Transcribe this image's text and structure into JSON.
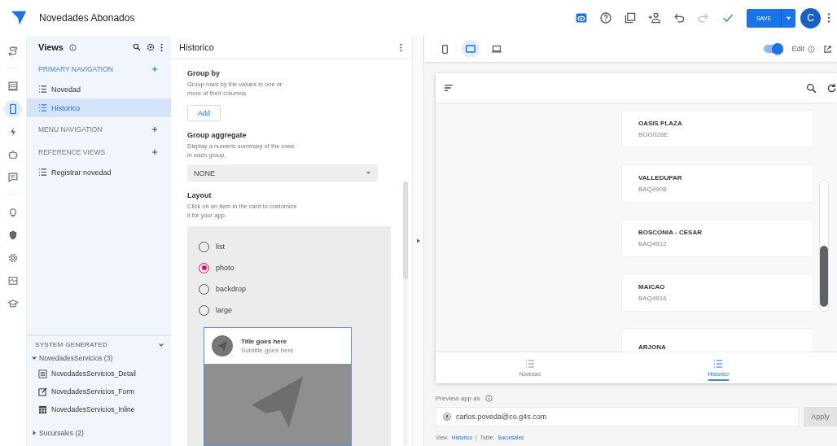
{
  "app": {
    "title": "Novedades Abonados",
    "save": "SAVE",
    "avatar": "C"
  },
  "views": {
    "title": "Views",
    "sections": [
      {
        "title": "PRIMARY NAVIGATION",
        "accent": true,
        "items": [
          {
            "label": "Novedad",
            "selected": false
          },
          {
            "label": "Historico",
            "selected": true
          }
        ]
      },
      {
        "title": "MENU NAVIGATION",
        "accent": false
      },
      {
        "title": "REFERENCE VIEWS",
        "accent": false,
        "items": [
          {
            "label": "Registrar novedad",
            "selected": false
          }
        ]
      }
    ],
    "system": {
      "title": "SYSTEM GENERATED",
      "groups": [
        {
          "label": "NovedadesServicios (3)",
          "expanded": true,
          "children": [
            {
              "label": "NovedadesServicios_Detail",
              "kind": "detail"
            },
            {
              "label": "NovedadesServicios_Form",
              "kind": "form"
            },
            {
              "label": "NovedadesServicios_Inline",
              "kind": "table"
            }
          ]
        },
        {
          "label": "Sucursales (2)",
          "expanded": false
        }
      ]
    }
  },
  "editor": {
    "title": "Historico",
    "group_by": {
      "title": "Group by",
      "help": "Group rows by the values in one or more of their columns.",
      "button": "Add"
    },
    "aggregate": {
      "title": "Group aggregate",
      "help": "Display a numeric summary of the rows in each group.",
      "value": "NONE"
    },
    "layout": {
      "title": "Layout",
      "help": "Click on an item in the card to customize it for your app.",
      "options": [
        {
          "label": "list",
          "selected": false
        },
        {
          "label": "photo",
          "selected": true
        },
        {
          "label": "backdrop",
          "selected": false
        },
        {
          "label": "large",
          "selected": false
        }
      ],
      "card": {
        "title": "Title goes here",
        "subtitle": "Subtitle goes here"
      }
    }
  },
  "preview": {
    "edit_label": "Edit",
    "edit_on": true,
    "devices": [
      {
        "kind": "phone",
        "selected": false
      },
      {
        "kind": "tablet",
        "selected": true
      },
      {
        "kind": "desktop",
        "selected": false
      }
    ],
    "cards": [
      {
        "title": "OASIS PLAZA",
        "subtitle": "BOG028E"
      },
      {
        "title": "VALLEDUPAR",
        "subtitle": "BAQ4908"
      },
      {
        "title": "BOSCONIA - CESAR",
        "subtitle": "BAQ4912"
      },
      {
        "title": "MAICAO",
        "subtitle": "BAQ4916"
      },
      {
        "title": "ARJONA"
      }
    ],
    "tabs": [
      {
        "label": "Novedad",
        "selected": false
      },
      {
        "label": "Historico",
        "selected": true
      }
    ],
    "preview_as": "Preview app as",
    "user": "carlos.poveda@co.g4s.com",
    "apply": "Apply",
    "footer": {
      "view_label": "View:",
      "view": "Historico",
      "sep": "|",
      "table_label": "Table:",
      "table": "Sucursales"
    }
  }
}
